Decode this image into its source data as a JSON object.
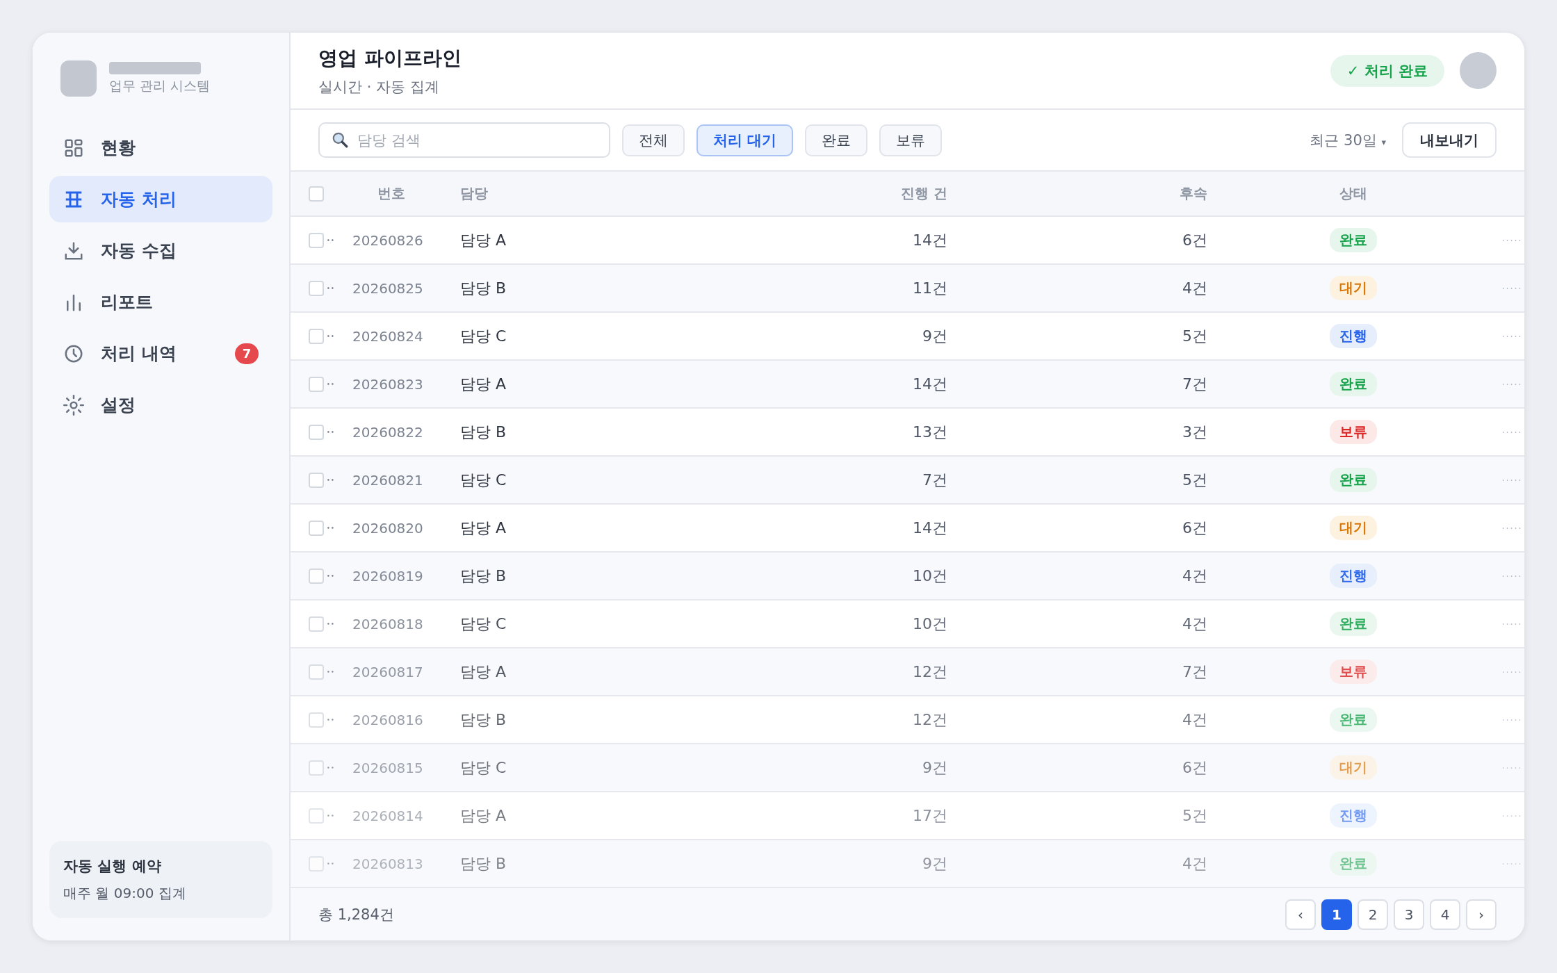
{
  "sidebar": {
    "subtitle": "업무 관리 시스템",
    "items": [
      {
        "label": "현황",
        "kind": "grid",
        "selected": false
      },
      {
        "label": "자동 처리",
        "kind": "table",
        "selected": true
      },
      {
        "label": "자동 수집",
        "kind": "download",
        "selected": false
      },
      {
        "label": "리포트",
        "kind": "bars",
        "selected": false
      },
      {
        "label": "처리 내역",
        "kind": "clock",
        "selected": false,
        "badge": "7"
      },
      {
        "label": "설정",
        "kind": "sun",
        "selected": false
      }
    ],
    "schedule": {
      "title": "자동 실행 예약",
      "detail": "매주 월 09:00 집계"
    }
  },
  "header": {
    "title": "영업 파이프라인",
    "subtitle": "실시간 · 자동 집계",
    "status": "✓ 처리 완료"
  },
  "toolbar": {
    "search": {
      "placeholder": "담당 검색"
    },
    "filters": [
      {
        "label": "전체",
        "selected": false
      },
      {
        "label": "처리 대기",
        "selected": true
      },
      {
        "label": "완료",
        "selected": false
      },
      {
        "label": "보류",
        "selected": false
      }
    ],
    "period": "최근 30일",
    "period_caret": "▾",
    "export": "내보내기"
  },
  "table": {
    "select_all_checked": false,
    "columns": [
      "번호",
      "담당",
      "진행 건",
      "후속",
      "상태"
    ],
    "rows": [
      {
        "checked": false,
        "number": "20260826",
        "owner": "담당 A",
        "count": "14건",
        "followup": "6건",
        "status": "완료",
        "kind": "done"
      },
      {
        "checked": false,
        "number": "20260825",
        "owner": "담당 B",
        "count": "11건",
        "followup": "4건",
        "status": "대기",
        "kind": "waiting"
      },
      {
        "checked": false,
        "number": "20260824",
        "owner": "담당 C",
        "count": "9건",
        "followup": "5건",
        "status": "진행",
        "kind": "progress"
      },
      {
        "checked": false,
        "number": "20260823",
        "owner": "담당 A",
        "count": "14건",
        "followup": "7건",
        "status": "완료",
        "kind": "done"
      },
      {
        "checked": false,
        "number": "20260822",
        "owner": "담당 B",
        "count": "13건",
        "followup": "3건",
        "status": "보류",
        "kind": "hold"
      },
      {
        "checked": false,
        "number": "20260821",
        "owner": "담당 C",
        "count": "7건",
        "followup": "5건",
        "status": "완료",
        "kind": "done"
      },
      {
        "checked": false,
        "number": "20260820",
        "owner": "담당 A",
        "count": "14건",
        "followup": "6건",
        "status": "대기",
        "kind": "waiting"
      },
      {
        "checked": false,
        "number": "20260819",
        "owner": "담당 B",
        "count": "10건",
        "followup": "4건",
        "status": "진행",
        "kind": "progress"
      },
      {
        "checked": false,
        "number": "20260818",
        "owner": "담당 C",
        "count": "10건",
        "followup": "4건",
        "status": "완료",
        "kind": "done"
      },
      {
        "checked": false,
        "number": "20260817",
        "owner": "담당 A",
        "count": "12건",
        "followup": "7건",
        "status": "보류",
        "kind": "hold"
      },
      {
        "checked": false,
        "number": "20260816",
        "owner": "담당 B",
        "count": "12건",
        "followup": "4건",
        "status": "완료",
        "kind": "done"
      },
      {
        "checked": false,
        "number": "20260815",
        "owner": "담당 C",
        "count": "9건",
        "followup": "6건",
        "status": "대기",
        "kind": "waiting"
      },
      {
        "checked": false,
        "number": "20260814",
        "owner": "담당 A",
        "count": "17건",
        "followup": "5건",
        "status": "진행",
        "kind": "progress"
      },
      {
        "checked": false,
        "number": "20260813",
        "owner": "담당 B",
        "count": "9건",
        "followup": "4건",
        "status": "완료",
        "kind": "done"
      }
    ]
  },
  "footer": {
    "total": "총 1,284건",
    "prev": "‹",
    "next": "›",
    "pages": [
      {
        "label": "1",
        "selected": true
      },
      {
        "label": "2",
        "selected": false
      },
      {
        "label": "3",
        "selected": false
      },
      {
        "label": "4",
        "selected": false
      }
    ]
  }
}
